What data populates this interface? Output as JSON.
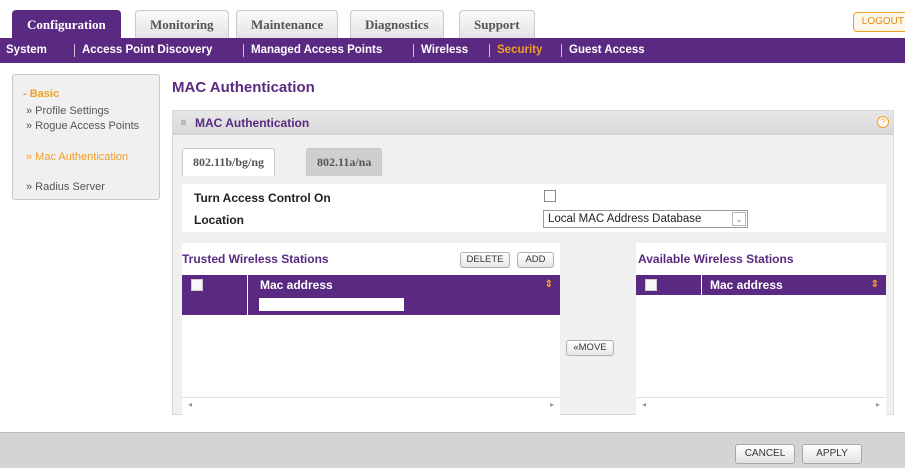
{
  "tabs": [
    "Configuration",
    "Monitoring",
    "Maintenance",
    "Diagnostics",
    "Support"
  ],
  "logout_label": "LOGOUT",
  "subnav": [
    "System",
    "Access Point Discovery",
    "Managed Access Points",
    "Wireless",
    "Security",
    "Guest Access"
  ],
  "sidebar": {
    "section": "- Basic",
    "items": [
      "» Profile Settings",
      "» Rogue Access Points",
      "» Mac Authentication",
      "» Radius Server"
    ]
  },
  "page_title": "MAC Authentication",
  "panel_title": "MAC Authentication",
  "help_icon": "?",
  "subtabs": [
    "802.11b/bg/ng",
    "802.11a/na"
  ],
  "form": {
    "access_control_label": "Turn Access Control On",
    "location_label": "Location",
    "location_value": "Local MAC Address Database",
    "location_arrow": "⌄"
  },
  "trusted": {
    "title": "Trusted Wireless Stations",
    "delete_label": "DELETE",
    "add_label": "ADD",
    "col_header": "Mac address",
    "sort_glyph": "⇕",
    "scroll_left": "◂",
    "scroll_right": "▸"
  },
  "move_label": "«MOVE",
  "available": {
    "title": "Available Wireless Stations",
    "col_header": "Mac address",
    "sort_glyph": "⇕",
    "scroll_left": "◂",
    "scroll_right": "▸"
  },
  "footer": {
    "cancel_label": "CANCEL",
    "apply_label": "APPLY"
  },
  "colors": {
    "brand_purple": "#5a2a82",
    "accent_orange": "#f0a020"
  }
}
